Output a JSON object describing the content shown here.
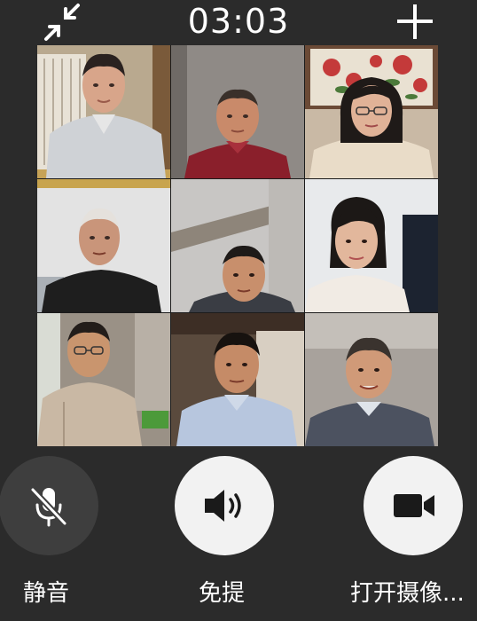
{
  "call": {
    "timer": "03:03",
    "minimize_icon": "minimize-arrows-icon",
    "add_icon": "plus-icon"
  },
  "participants": [
    {
      "id": 1,
      "shirt_color": "#cfd2d6",
      "bg_color": "#b9a98f"
    },
    {
      "id": 2,
      "shirt_color": "#8a1f2b",
      "bg_color": "#8f8a86"
    },
    {
      "id": 3,
      "shirt_color": "#e9dcc8",
      "bg_color": "#c9b9a5"
    },
    {
      "id": 4,
      "shirt_color": "#1e1e1e",
      "bg_color": "#e3e3e3"
    },
    {
      "id": 5,
      "shirt_color": "#3a3d44",
      "bg_color": "#c8c6c4"
    },
    {
      "id": 6,
      "shirt_color": "#f1ebe4",
      "bg_color": "#e8eaec"
    },
    {
      "id": 7,
      "shirt_color": "#c9b8a4",
      "bg_color": "#9a9186"
    },
    {
      "id": 8,
      "shirt_color": "#b7c6de",
      "bg_color": "#5a4a3d"
    },
    {
      "id": 9,
      "shirt_color": "#4c5260",
      "bg_color": "#a8a29c"
    }
  ],
  "controls": {
    "mute": {
      "label": "静音",
      "icon": "microphone-off-icon",
      "active": false
    },
    "speaker": {
      "label": "免提",
      "icon": "speaker-icon",
      "active": true
    },
    "camera": {
      "label": "打开摄像...",
      "icon": "video-camera-icon",
      "active": true
    }
  },
  "colors": {
    "background": "#2b2b2b",
    "button_light": "#f2f2f2",
    "button_dark": "#3e3e3e",
    "text": "#ffffff"
  }
}
